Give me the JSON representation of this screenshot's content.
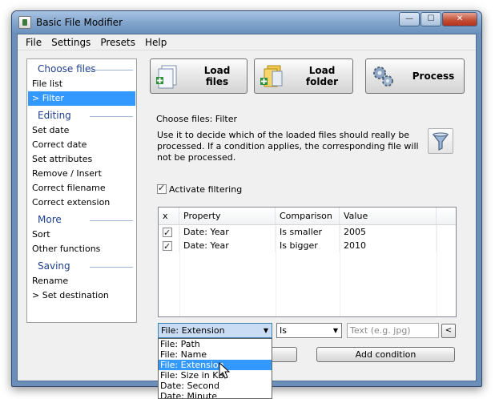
{
  "window": {
    "title": "Basic File Modifier",
    "min_glyph": "—",
    "max_glyph": "☐",
    "close_glyph": "✕"
  },
  "menu": [
    "File",
    "Settings",
    "Presets",
    "Help"
  ],
  "sidebar": {
    "groups": [
      {
        "heading": "Choose files",
        "items": [
          "File list",
          "> Filter"
        ]
      },
      {
        "heading": "Editing",
        "items": [
          "Set date",
          "Correct date",
          "Set attributes",
          "Remove / Insert",
          "Correct filename",
          "Correct extension"
        ]
      },
      {
        "heading": "More",
        "items": [
          "Sort",
          "Other functions"
        ]
      },
      {
        "heading": "Saving",
        "items": [
          "Rename",
          "> Set destination"
        ]
      }
    ],
    "selected": "> Filter"
  },
  "toolbar": {
    "load_files": "Load files",
    "load_folder": "Load folder",
    "process": "Process"
  },
  "panel": {
    "title": "Choose files: Filter",
    "description": "Use it to decide which of the loaded files should really be processed. If a condition applies, the corresponding file will not be processed.",
    "activate_label": "Activate filtering",
    "activate_checked": true
  },
  "table": {
    "columns": [
      "x",
      "Property",
      "Comparison",
      "Value"
    ],
    "rows": [
      {
        "checked": true,
        "property": "Date: Year",
        "comparison": "Is smaller",
        "value": "2005"
      },
      {
        "checked": true,
        "property": "Date: Year",
        "comparison": "Is bigger",
        "value": "2010"
      }
    ]
  },
  "controls": {
    "property_selected": "File: Extension",
    "comparison_selected": "Is",
    "text_placeholder": "Text  (e.g. jpg)",
    "small_button": "<",
    "add_condition": "Add condition"
  },
  "dropdown": {
    "options": [
      "File: Path",
      "File: Name",
      "File: Extension",
      "File: Size in KB",
      "Date: Second",
      "Date: Minute"
    ],
    "highlighted": "File: Extension"
  },
  "colors": {
    "selection": "#3399ff",
    "heading": "#1e3f8f"
  }
}
